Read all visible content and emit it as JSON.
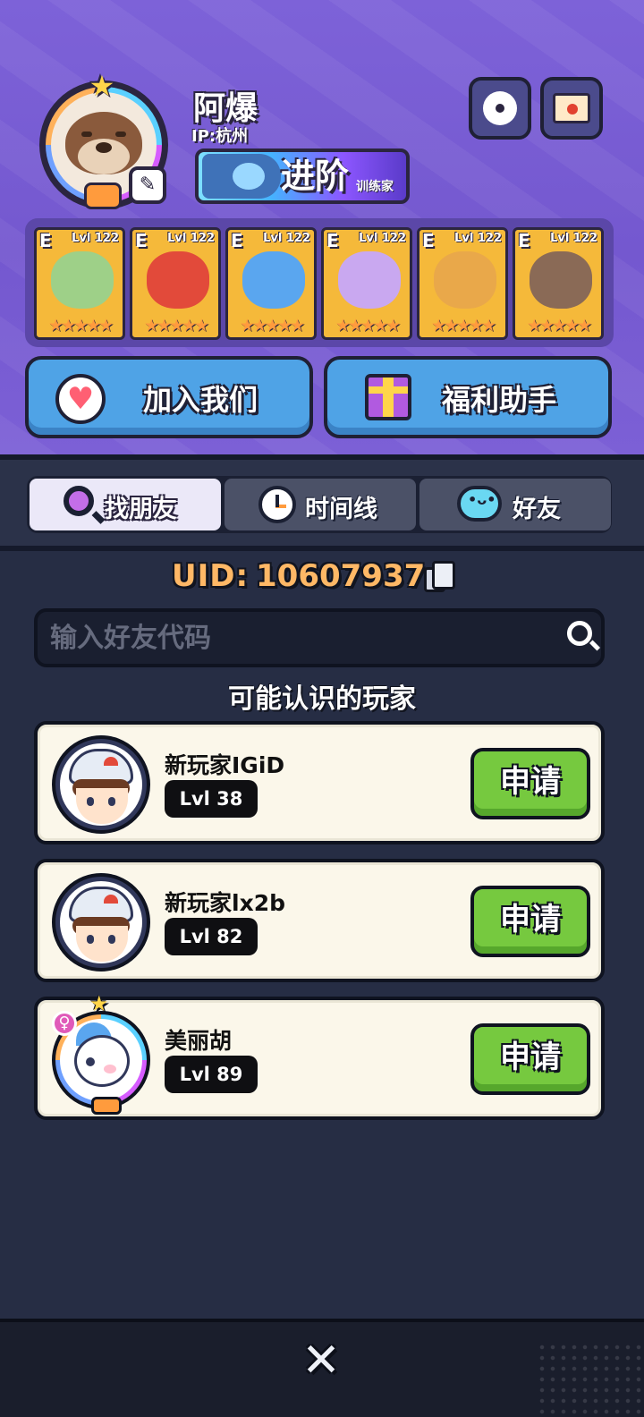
{
  "profile": {
    "username": "阿爆",
    "ip": "IP:杭州",
    "rank_title": "进阶",
    "rank_subtitle": "训练家"
  },
  "header_icons": [
    "gear-icon",
    "mail-icon"
  ],
  "team": [
    {
      "grade": "E",
      "level": "Lvl 122",
      "stars": "★★★★★",
      "color": "#9ed088"
    },
    {
      "grade": "E",
      "level": "Lvl 122",
      "stars": "★★★★★",
      "color": "#e24a3a"
    },
    {
      "grade": "E",
      "level": "Lvl 122",
      "stars": "★★★★★",
      "color": "#5aa6ef"
    },
    {
      "grade": "E",
      "level": "Lvl 122",
      "stars": "★★★★★",
      "color": "#c9a8f0"
    },
    {
      "grade": "E",
      "level": "Lvl 122",
      "stars": "★★★★★",
      "color": "#e9a84a"
    },
    {
      "grade": "E",
      "level": "Lvl 122",
      "stars": "★★★★★",
      "color": "#8a6a56"
    }
  ],
  "actions": {
    "join_label": "加入我们",
    "benefit_label": "福利助手"
  },
  "tabs": [
    {
      "label": "找朋友",
      "icon": "search-icon",
      "active": true
    },
    {
      "label": "时间线",
      "icon": "clock-icon",
      "active": false
    },
    {
      "label": "好友",
      "icon": "chat-icon",
      "active": false
    }
  ],
  "uid": {
    "label": "UID:",
    "value": "10607937"
  },
  "search": {
    "placeholder": "输入好友代码",
    "value": ""
  },
  "suggested": {
    "title": "可能认识的玩家",
    "players": [
      {
        "name": "新玩家IGiD",
        "level": "Lvl 38",
        "button": "申请"
      },
      {
        "name": "新玩家lx2b",
        "level": "Lvl 82",
        "button": "申请"
      },
      {
        "name": "美丽胡",
        "level": "Lvl 89",
        "button": "申请",
        "gender_icon": "♀"
      }
    ]
  },
  "colors": {
    "header_bg": "#7458cf",
    "action_button": "#4fa3e6",
    "apply_button": "#76c93f",
    "uid_text": "#ffb866"
  }
}
